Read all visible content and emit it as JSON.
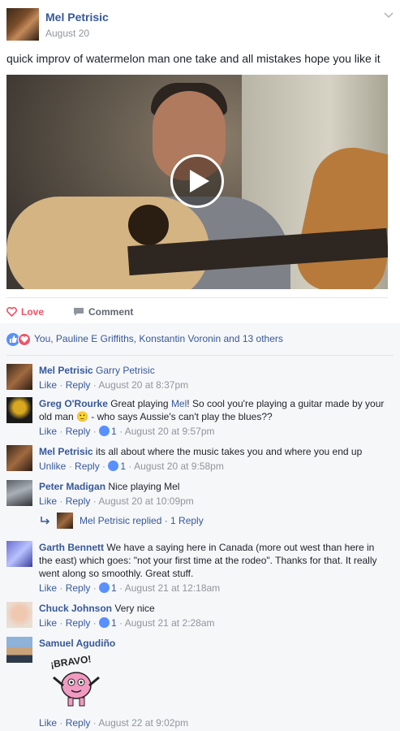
{
  "post": {
    "author": "Mel Petrisic",
    "date": "August 20",
    "text": "quick improv of watermelon man one take and all mistakes hope you like it"
  },
  "actions": {
    "love_label": "Love",
    "comment_label": "Comment"
  },
  "reactions_summary": "You, Pauline E Griffiths, Konstantin Voronin and 13 others",
  "comments": [
    {
      "name": "Mel Petrisic",
      "text": "Garry Petrisic",
      "meta_action": "Like",
      "reply": "Reply",
      "likes": "",
      "time": "August 20 at 8:37pm"
    },
    {
      "name": "Greg O'Rourke",
      "text_before": "Great playing ",
      "mention": "Mel",
      "text_after": "! So cool you're playing a guitar made by your old man 🙂 - who says Aussie's can't play the blues??",
      "meta_action": "Like",
      "reply": "Reply",
      "likes": "1",
      "time": "August 20 at 9:57pm"
    },
    {
      "name": "Mel Petrisic",
      "text": "its all about where the music takes you and where you end up",
      "meta_action": "Unlike",
      "reply": "Reply",
      "likes": "1",
      "time": "August 20 at 9:58pm"
    },
    {
      "name": "Peter Madigan",
      "text": "Nice playing Mel",
      "meta_action": "Like",
      "reply": "Reply",
      "likes": "",
      "time": "August 20 at 10:09pm",
      "replies_label": "Mel Petrisic replied · 1 Reply"
    },
    {
      "name": "Garth Bennett",
      "text": "We have a saying here in Canada (more out west than here in the east) which goes: \"not your first time at the rodeo\". Thanks for that. It really went along so smoothly. Great stuff.",
      "meta_action": "Like",
      "reply": "Reply",
      "likes": "1",
      "time": "August 21 at 12:18am"
    },
    {
      "name": "Chuck Johnson",
      "text": "Very nice",
      "meta_action": "Like",
      "reply": "Reply",
      "likes": "1",
      "time": "August 21 at 2:28am"
    },
    {
      "name": "Samuel Agudiño",
      "text": "",
      "sticker_text": "¡BRAVO!",
      "meta_action": "Like",
      "reply": "Reply",
      "likes": "",
      "time": "August 22 at 9:02pm"
    }
  ],
  "colors": {
    "link": "#365899",
    "meta": "#90949c",
    "love": "#f25268",
    "like": "#5890ff",
    "comment_bg": "#f6f7f9"
  },
  "icons": [
    "chevron-down-icon",
    "play-icon",
    "heart-icon",
    "comment-icon",
    "like-reaction-icon",
    "love-reaction-icon",
    "reply-arrow-icon"
  ]
}
